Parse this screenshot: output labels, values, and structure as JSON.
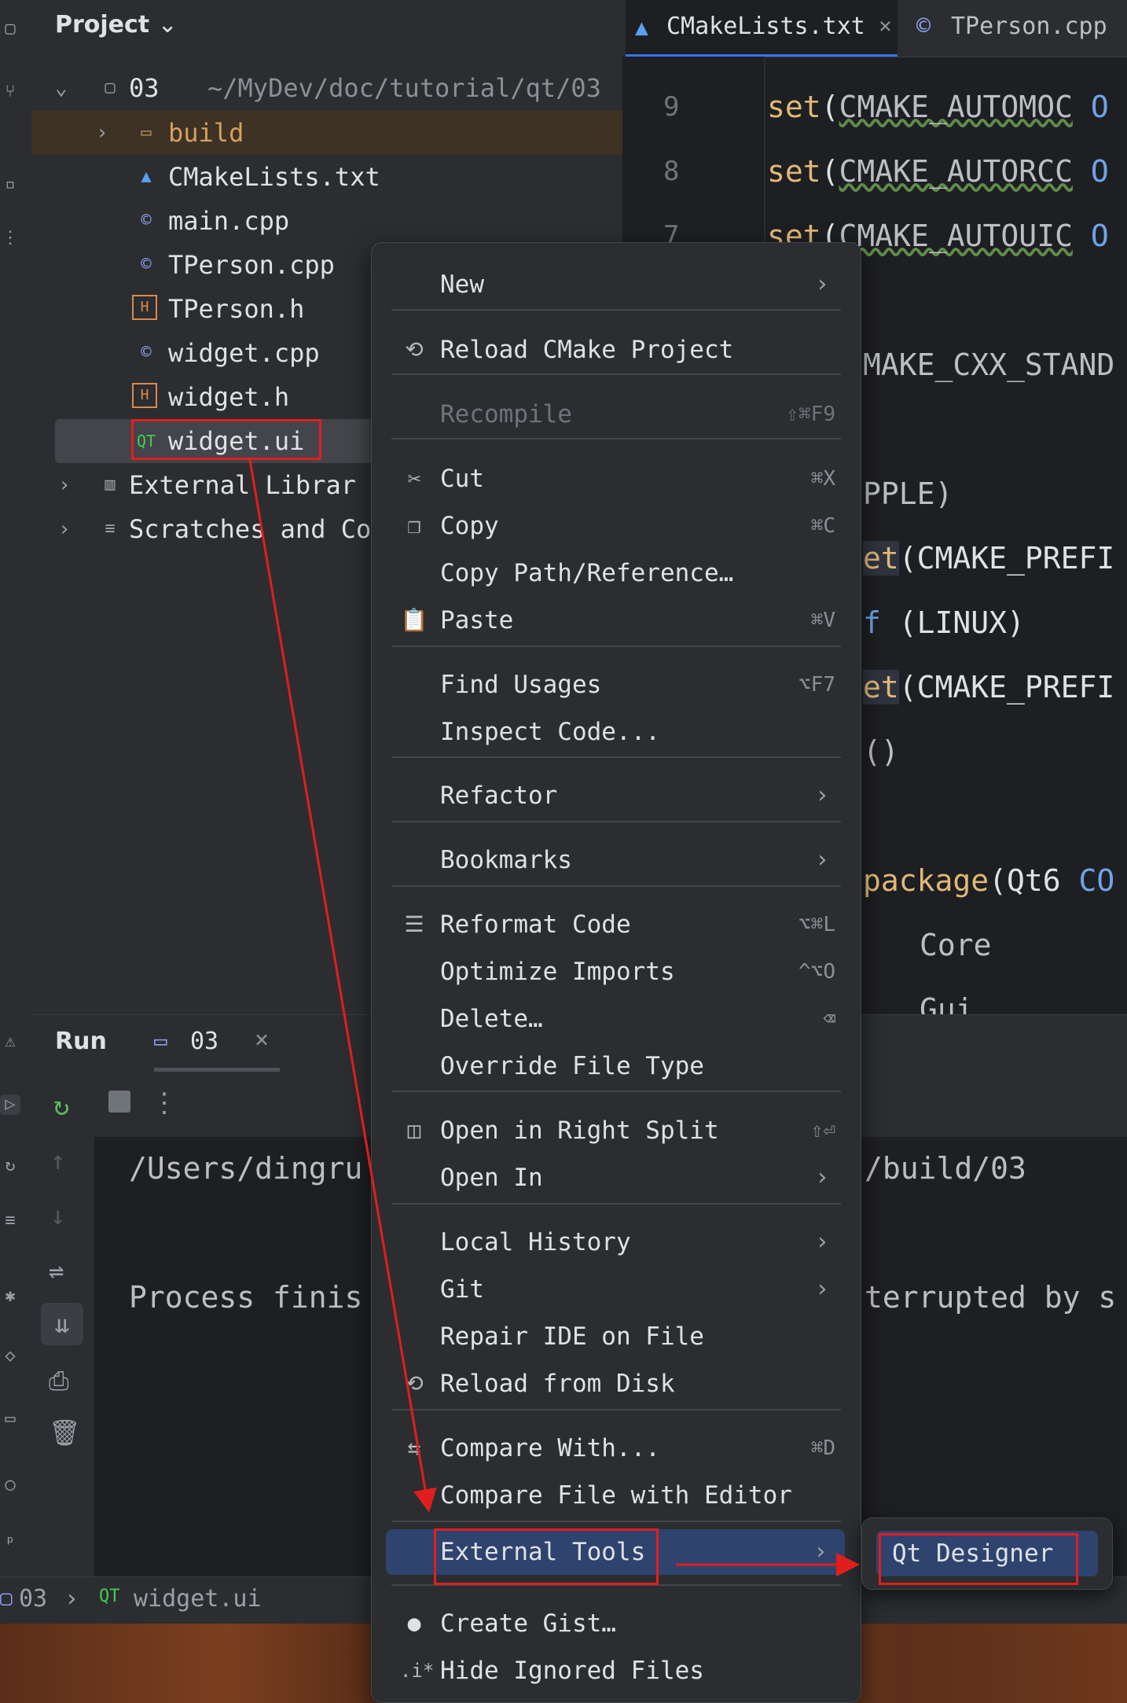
{
  "project_panel": {
    "title": "Project",
    "root": {
      "name": "03",
      "path": "~/MyDev/doc/tutorial/qt/03"
    },
    "items": [
      {
        "name": "build",
        "icon": "folder-icon"
      },
      {
        "name": "CMakeLists.txt",
        "icon": "cmake-icon"
      },
      {
        "name": "main.cpp",
        "icon": "cpp-file-icon"
      },
      {
        "name": "TPerson.cpp",
        "icon": "cpp-file-icon"
      },
      {
        "name": "TPerson.h",
        "icon": "header-file-icon"
      },
      {
        "name": "widget.cpp",
        "icon": "cpp-file-icon"
      },
      {
        "name": "widget.h",
        "icon": "header-file-icon"
      },
      {
        "name": "widget.ui",
        "icon": "qt-ui-file-icon"
      }
    ],
    "external_libraries": "External Librar",
    "scratches": "Scratches and Co"
  },
  "editor": {
    "tabs": [
      {
        "label": "CMakeLists.txt",
        "active": true
      },
      {
        "label": "TPerson.cpp",
        "active": false
      }
    ],
    "line_numbers": [
      "9",
      "8",
      "7"
    ],
    "lines": {
      "l1_kw": "set",
      "l1_rest": "(",
      "l1_var": "CMAKE_AUTOMOC",
      "l1_end": " O",
      "l2_kw": "set",
      "l2_rest": "(",
      "l2_var": "CMAKE_AUTORCC",
      "l2_end": " O",
      "l3_kw": "set",
      "l3_rest": "(",
      "l3_var": "CMAKE_AUTOUIC",
      "l3_end": " O",
      "l4": "MAKE_CXX_STAND",
      "l5": "PPLE)",
      "l6_kw": "et",
      "l6_rest": "(CMAKE_PREFI",
      "l7_kw": "f",
      "l7_rest": " (LINUX)",
      "l8_kw": "et",
      "l8_rest": "(CMAKE_PREFI",
      "l9": " ()",
      "l10_kw": "package",
      "l10_rest": "(Qt6 ",
      "l10_blue": "CO",
      "l11": "Core",
      "l12": "Gui"
    }
  },
  "run_panel": {
    "title": "Run",
    "tab_label": "03",
    "console_line1_left": "/Users/dingru",
    "console_line1_right": "/build/03",
    "console_line2_left": "Process finis",
    "console_line2_right": "terrupted by s"
  },
  "status_bar": {
    "project": "03",
    "file": "widget.ui"
  },
  "context_menu": {
    "new": "New",
    "reload_cmake": "Reload CMake Project",
    "recompile": "Recompile",
    "recompile_shortcut": "⇧⌘F9",
    "cut": "Cut",
    "cut_shortcut": "⌘X",
    "copy": "Copy",
    "copy_shortcut": "⌘C",
    "copy_path": "Copy Path/Reference…",
    "paste": "Paste",
    "paste_shortcut": "⌘V",
    "find_usages": "Find Usages",
    "find_usages_shortcut": "⌥F7",
    "inspect_code": "Inspect Code...",
    "refactor": "Refactor",
    "bookmarks": "Bookmarks",
    "reformat_code": "Reformat Code",
    "reformat_shortcut": "⌥⌘L",
    "optimize_imports": "Optimize Imports",
    "optimize_shortcut": "^⌥O",
    "delete": "Delete…",
    "override_file_type": "Override File Type",
    "open_right_split": "Open in Right Split",
    "open_right_split_shortcut": "⇧⏎",
    "open_in": "Open In",
    "local_history": "Local History",
    "git": "Git",
    "repair_ide": "Repair IDE on File",
    "reload_from_disk": "Reload from Disk",
    "compare_with": "Compare With...",
    "compare_with_shortcut": "⌘D",
    "compare_file_editor": "Compare File with Editor",
    "external_tools": "External Tools",
    "create_gist": "Create Gist…",
    "hide_ignored": "Hide Ignored Files",
    "hide_ignored_icon_text": ".i*"
  },
  "submenu": {
    "qt_designer": "Qt Designer"
  },
  "colors": {
    "annotation_red": "#e01e1e",
    "selection_blue": "#2e436e",
    "keyword_orange": "#cf8e6d",
    "function_yellow": "#e0b877"
  }
}
